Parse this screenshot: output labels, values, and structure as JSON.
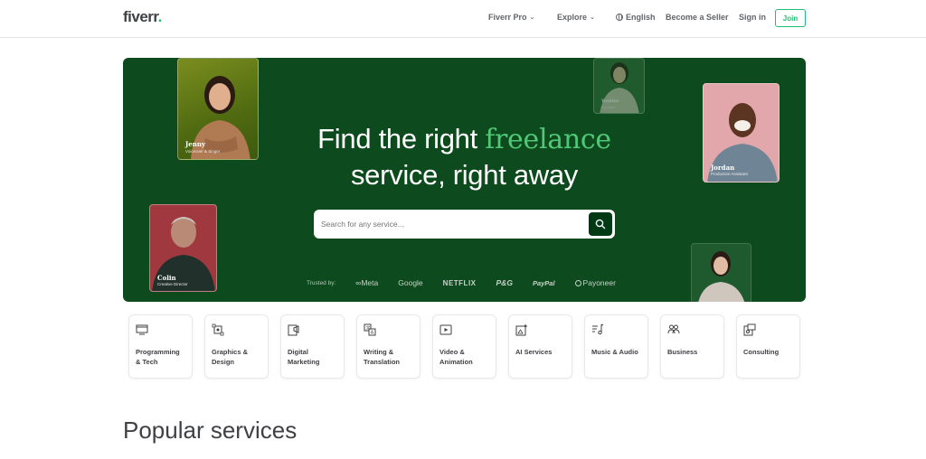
{
  "header": {
    "logo": "fiverr",
    "logo_dot": ".",
    "fiverr_pro": "Fiverr Pro",
    "explore": "Explore",
    "language": "English",
    "become_seller": "Become a Seller",
    "sign_in": "Sign in",
    "join": "Join"
  },
  "hero": {
    "title_part1": "Find the right ",
    "title_accent": "freelance",
    "title_part2": "service, right away",
    "search_placeholder": "Search for any service...",
    "trusted_label": "Trusted by:",
    "brands": [
      "∞Meta",
      "Google",
      "NETFLIX",
      "P&G",
      "PayPal",
      "Payoneer"
    ],
    "people": [
      {
        "name": "Jenny",
        "role": "Voiceover & Singer"
      },
      {
        "name": "Jordan",
        "role": "Production Assistant"
      },
      {
        "name": "Colin",
        "role": "Creative Director"
      },
      {
        "name": "Yoshiko",
        "role": "Translator"
      }
    ]
  },
  "categories": [
    {
      "label_line1": "Programming",
      "label_line2": "& Tech",
      "icon": "code-monitor-icon"
    },
    {
      "label_line1": "Graphics &",
      "label_line2": "Design",
      "icon": "design-frame-icon"
    },
    {
      "label_line1": "Digital",
      "label_line2": "Marketing",
      "icon": "marketing-icon"
    },
    {
      "label_line1": "Writing &",
      "label_line2": "Translation",
      "icon": "translation-icon"
    },
    {
      "label_line1": "Video &",
      "label_line2": "Animation",
      "icon": "video-play-icon"
    },
    {
      "label_line1": "AI Services",
      "label_line2": "",
      "icon": "ai-sparkle-icon"
    },
    {
      "label_line1": "Music & Audio",
      "label_line2": "",
      "icon": "music-icon"
    },
    {
      "label_line1": "Business",
      "label_line2": "",
      "icon": "business-people-icon"
    },
    {
      "label_line1": "Consulting",
      "label_line2": "",
      "icon": "consulting-icon"
    }
  ],
  "popular": {
    "title": "Popular services"
  },
  "colors": {
    "hero_bg": "#0d4a1d",
    "accent": "#1dbf73",
    "search_btn": "#013914"
  }
}
